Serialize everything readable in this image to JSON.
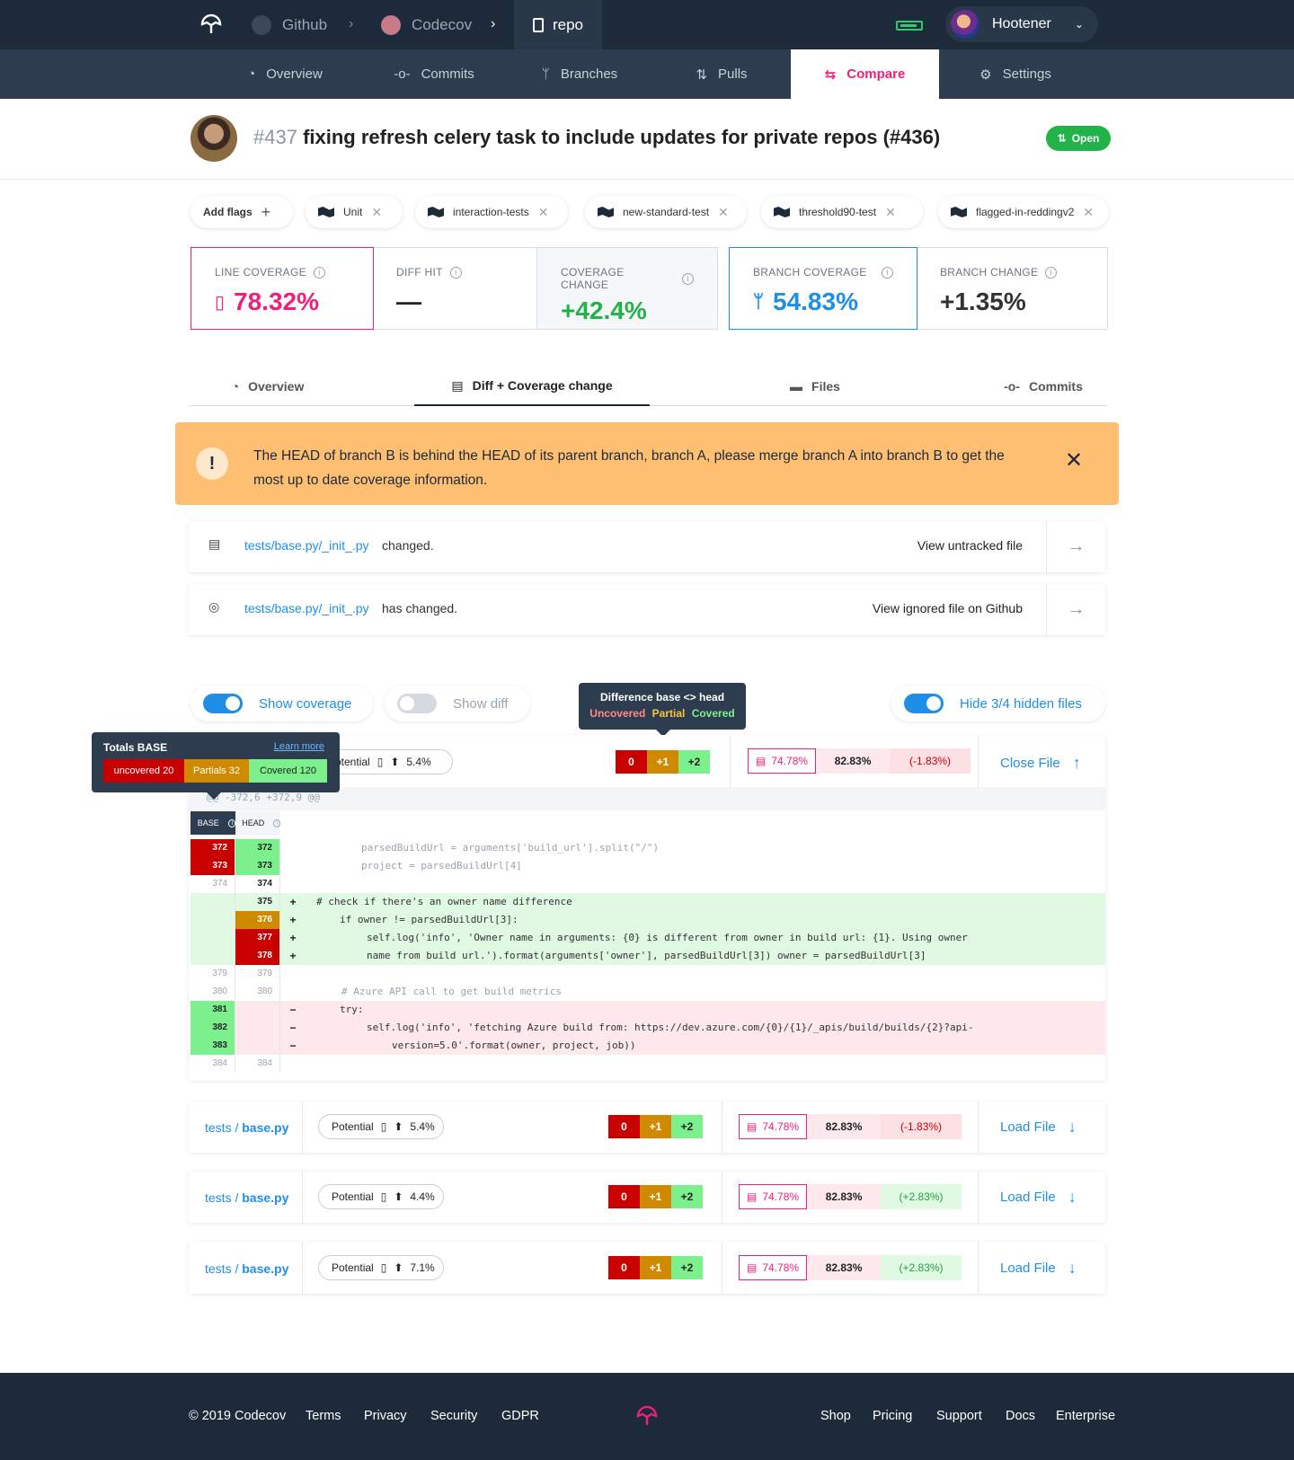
{
  "topbar": {
    "crumbs": [
      "Github",
      "Codecov"
    ],
    "repo": "repo",
    "user": "Hootener"
  },
  "subnav": [
    "Overview",
    "Commits",
    "Branches",
    "Pulls",
    "Compare",
    "Settings"
  ],
  "pr": {
    "number": "#437",
    "title": "fixing refresh celery task to include updates for private repos (#436)",
    "status": "Open"
  },
  "flags": {
    "add": "Add flags",
    "items": [
      "Unit",
      "interaction-tests",
      "new-standard-test",
      "threshold90-test",
      "flagged-in-reddingv2"
    ]
  },
  "cards": {
    "line_coverage": {
      "label": "LINE COVERAGE",
      "value": "78.32%"
    },
    "diff_hit": {
      "label": "DIFF HIT",
      "value": "—"
    },
    "coverage_change": {
      "label": "COVERAGE CHANGE",
      "value": "+42.4%"
    },
    "branch_coverage": {
      "label": "BRANCH COVERAGE",
      "value": "54.83%"
    },
    "branch_change": {
      "label": "BRANCH CHANGE",
      "value": "+1.35%"
    }
  },
  "tabs": [
    "Overview",
    "Diff + Coverage change",
    "Files",
    "Commits"
  ],
  "warning": "The HEAD of branch B is behind the HEAD of its parent branch, branch A, please merge branch A into branch B to get the most up to date coverage information.",
  "untracked": [
    {
      "link": "tests/base.py/_init_.py",
      "text": "changed.",
      "action": "View untracked file"
    },
    {
      "link": "tests/base.py/_init_.py",
      "text": "has changed.",
      "action": "View ignored file on Github"
    }
  ],
  "toggles": {
    "show_coverage": "Show coverage",
    "show_diff": "Show diff",
    "hide_hidden": "Hide 3/4 hidden files"
  },
  "diff_tooltip": {
    "title": "Difference base <> head",
    "uncovered": "Uncovered",
    "partial": "Partial",
    "covered": "Covered"
  },
  "base_tooltip": {
    "title": "Totals BASE",
    "learn": "Learn more",
    "uncovered": "uncovered 20",
    "partials": "Partials 32",
    "covered": "Covered 120"
  },
  "open_file": {
    "potential": "Potential",
    "potential_pct": "5.4%",
    "tri": [
      "0",
      "+1",
      "+2"
    ],
    "cov_a": "74.78%",
    "cov_b": "82.83%",
    "cov_c": "(-1.83%)",
    "close": "Close File",
    "hunk": "@@ -372,6 +372,9 @@",
    "col_base": "BASE",
    "col_head": "HEAD",
    "lines": [
      {
        "b": "372",
        "h": "372",
        "s": "",
        "c": "parsedBuildUrl = arguments['build_url'].split(\"/\")"
      },
      {
        "b": "373",
        "h": "373",
        "s": "",
        "c": "project = parsedBuildUrl[4]"
      },
      {
        "b": "374",
        "h": "374",
        "s": "",
        "c": ""
      },
      {
        "b": "",
        "h": "375",
        "s": "+",
        "c": "# check if there's an owner name difference"
      },
      {
        "b": "",
        "h": "376",
        "s": "+",
        "c": "if owner != parsedBuildUrl[3]:"
      },
      {
        "b": "",
        "h": "377",
        "s": "+",
        "c": "self.log('info', 'Owner name in arguments: {0} is different from owner in build url: {1}. Using owner"
      },
      {
        "b": "",
        "h": "378",
        "s": "+",
        "c": "name from build url.').format(arguments['owner'], parsedBuildUrl[3]) owner = parsedBuildUrl[3]"
      },
      {
        "b": "379",
        "h": "379",
        "s": "",
        "c": ""
      },
      {
        "b": "380",
        "h": "380",
        "s": "",
        "c": "# Azure API call to get build metrics"
      },
      {
        "b": "381",
        "h": "",
        "s": "−",
        "c": "try:"
      },
      {
        "b": "382",
        "h": "",
        "s": "−",
        "c": "self.log('info', 'fetching Azure build from: https://dev.azure.com/{0}/{1}/_apis/build/builds/{2}?api-"
      },
      {
        "b": "383",
        "h": "",
        "s": "−",
        "c": "version=5.0'.format(owner, project, job))"
      },
      {
        "b": "384",
        "h": "384",
        "s": "",
        "c": ""
      }
    ]
  },
  "files": [
    {
      "dir": "tests",
      "file": "base.py",
      "potential": "Potential",
      "pct": "5.4%",
      "tri": [
        "0",
        "+1",
        "+2"
      ],
      "a": "74.78%",
      "b": "82.83%",
      "c": "(-1.83%)",
      "load": "Load File"
    },
    {
      "dir": "tests",
      "file": "base.py",
      "potential": "Potential",
      "pct": "4.4%",
      "tri": [
        "0",
        "+1",
        "+2"
      ],
      "a": "74.78%",
      "b": "82.83%",
      "c": "(+2.83%)",
      "load": "Load File"
    },
    {
      "dir": "tests",
      "file": "base.py",
      "potential": "Potential",
      "pct": "7.1%",
      "tri": [
        "0",
        "+1",
        "+2"
      ],
      "a": "74.78%",
      "b": "82.83%",
      "c": "(+2.83%)",
      "load": "Load File"
    }
  ],
  "footer": {
    "copy": "© 2019 Codecov",
    "left": [
      "Terms",
      "Privacy",
      "Security",
      "GDPR"
    ],
    "right": [
      "Shop",
      "Pricing",
      "Support",
      "Docs",
      "Enterprise"
    ]
  },
  "colors": {
    "brand": "#f01f7a",
    "accent": "#1f8ee6",
    "navy": "#1c2a3a",
    "green": "#21b34a",
    "warning": "#ffbf73"
  }
}
